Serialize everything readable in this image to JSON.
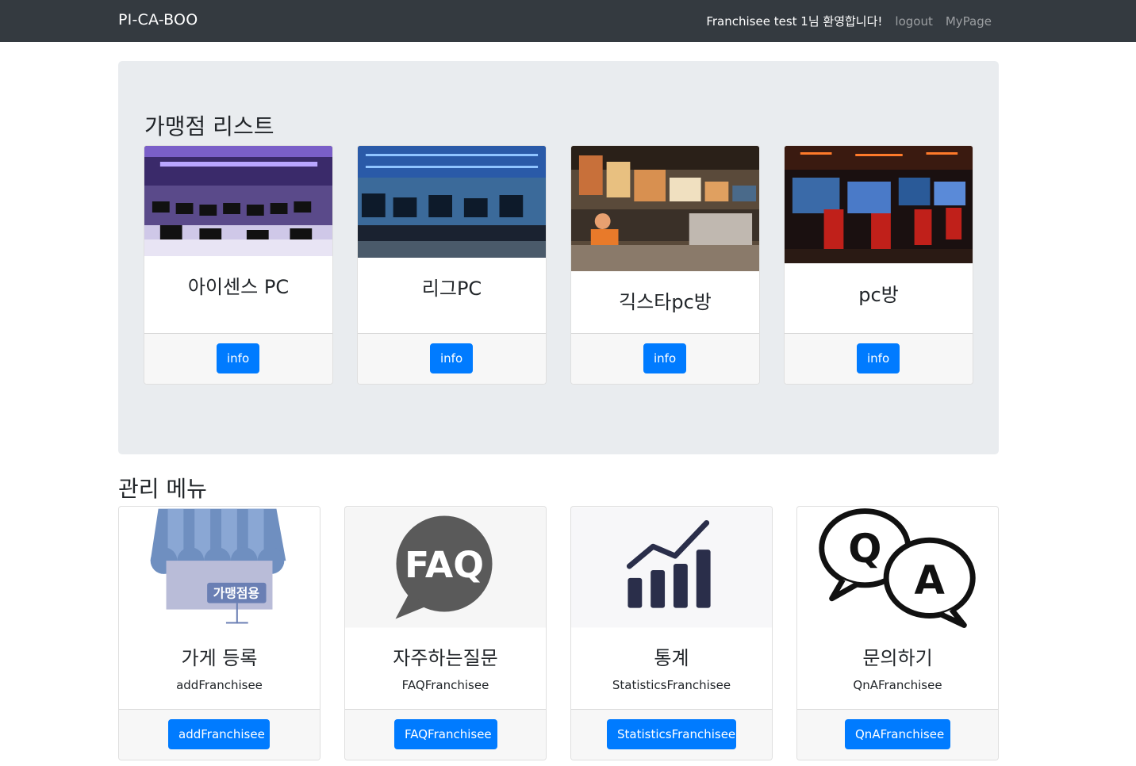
{
  "navbar": {
    "brand": "PI-CA-BOO",
    "welcome": "Franchisee test 1님 환영합니다!",
    "logout_label": "logout",
    "mypage_label": "MyPage"
  },
  "franchise_section": {
    "title": "가맹점 리스트",
    "cards": [
      {
        "name": "아이센스 PC",
        "button_label": "info",
        "image": "pc-room-purple-photo"
      },
      {
        "name": "리그PC",
        "button_label": "info",
        "image": "pc-room-blue-photo"
      },
      {
        "name": "긱스타pc방",
        "button_label": "info",
        "image": "pc-cafe-food-counter-photo"
      },
      {
        "name": "pc방",
        "button_label": "info",
        "image": "pc-room-red-chairs-photo"
      }
    ]
  },
  "admin_section": {
    "title": "관리 메뉴",
    "cards": [
      {
        "title": "가게 등록",
        "subtitle": "addFranchisee",
        "button_label": "addFranchisee",
        "icon": "storefront-icon",
        "icon_text": "가맹점용"
      },
      {
        "title": "자주하는질문",
        "subtitle": "FAQFranchisee",
        "button_label": "FAQFranchisee",
        "icon": "faq-bubble-icon",
        "icon_text": "FAQ"
      },
      {
        "title": "통계",
        "subtitle": "StatisticsFranchisee",
        "button_label": "StatisticsFranchisee",
        "icon": "bar-chart-icon"
      },
      {
        "title": "문의하기",
        "subtitle": "QnAFranchisee",
        "button_label": "QnAFranchisee",
        "icon": "qna-bubbles-icon",
        "icon_text": "Q A"
      }
    ]
  },
  "colors": {
    "navbar": "#343a40",
    "jumbotron": "#e9ecef",
    "primary": "#007bff"
  }
}
